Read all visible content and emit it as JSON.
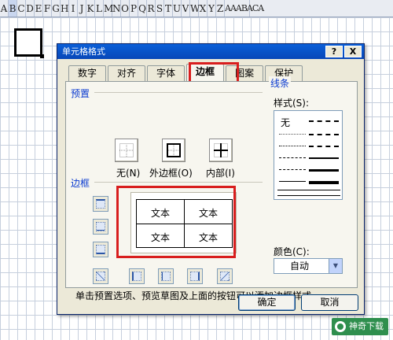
{
  "sheet": {
    "columns": [
      "A",
      "B",
      "C",
      "D",
      "E",
      "F",
      "G",
      "H",
      "I",
      "J",
      "K",
      "L",
      "M",
      "N",
      "O",
      "P",
      "Q",
      "R",
      "S",
      "T",
      "U",
      "V",
      "W",
      "X",
      "Y",
      "Z",
      "AAABACA"
    ],
    "selected_column": "B"
  },
  "dialog": {
    "title": "单元格格式",
    "help_label": "?",
    "close_label": "X",
    "tabs": [
      {
        "label": "数字"
      },
      {
        "label": "对齐"
      },
      {
        "label": "字体"
      },
      {
        "label": "边框",
        "active": true
      },
      {
        "label": "图案"
      },
      {
        "label": "保护"
      }
    ],
    "presets_title": "预置",
    "presets": [
      {
        "label": "无(N)",
        "icon": "border-none-icon"
      },
      {
        "label": "外边框(O)",
        "icon": "border-outline-icon"
      },
      {
        "label": "内部(I)",
        "icon": "border-inside-icon"
      }
    ],
    "border_title": "边框",
    "preview_cells": [
      "文本",
      "文本",
      "文本",
      "文本"
    ],
    "hint": "单击预置选项、预览草图及上面的按钮可以添加边框样式。",
    "line_title": "线条",
    "style_label": "样式(S):",
    "style_none": "无",
    "color_label": "颜色(C):",
    "color_value": "自动",
    "ok_label": "确定",
    "cancel_label": "取消"
  },
  "watermark": "神奇下载",
  "colors": {
    "highlight": "#d81e1e",
    "titlebar": "#0a5fd8",
    "dialog_bg": "#ece9d8"
  }
}
